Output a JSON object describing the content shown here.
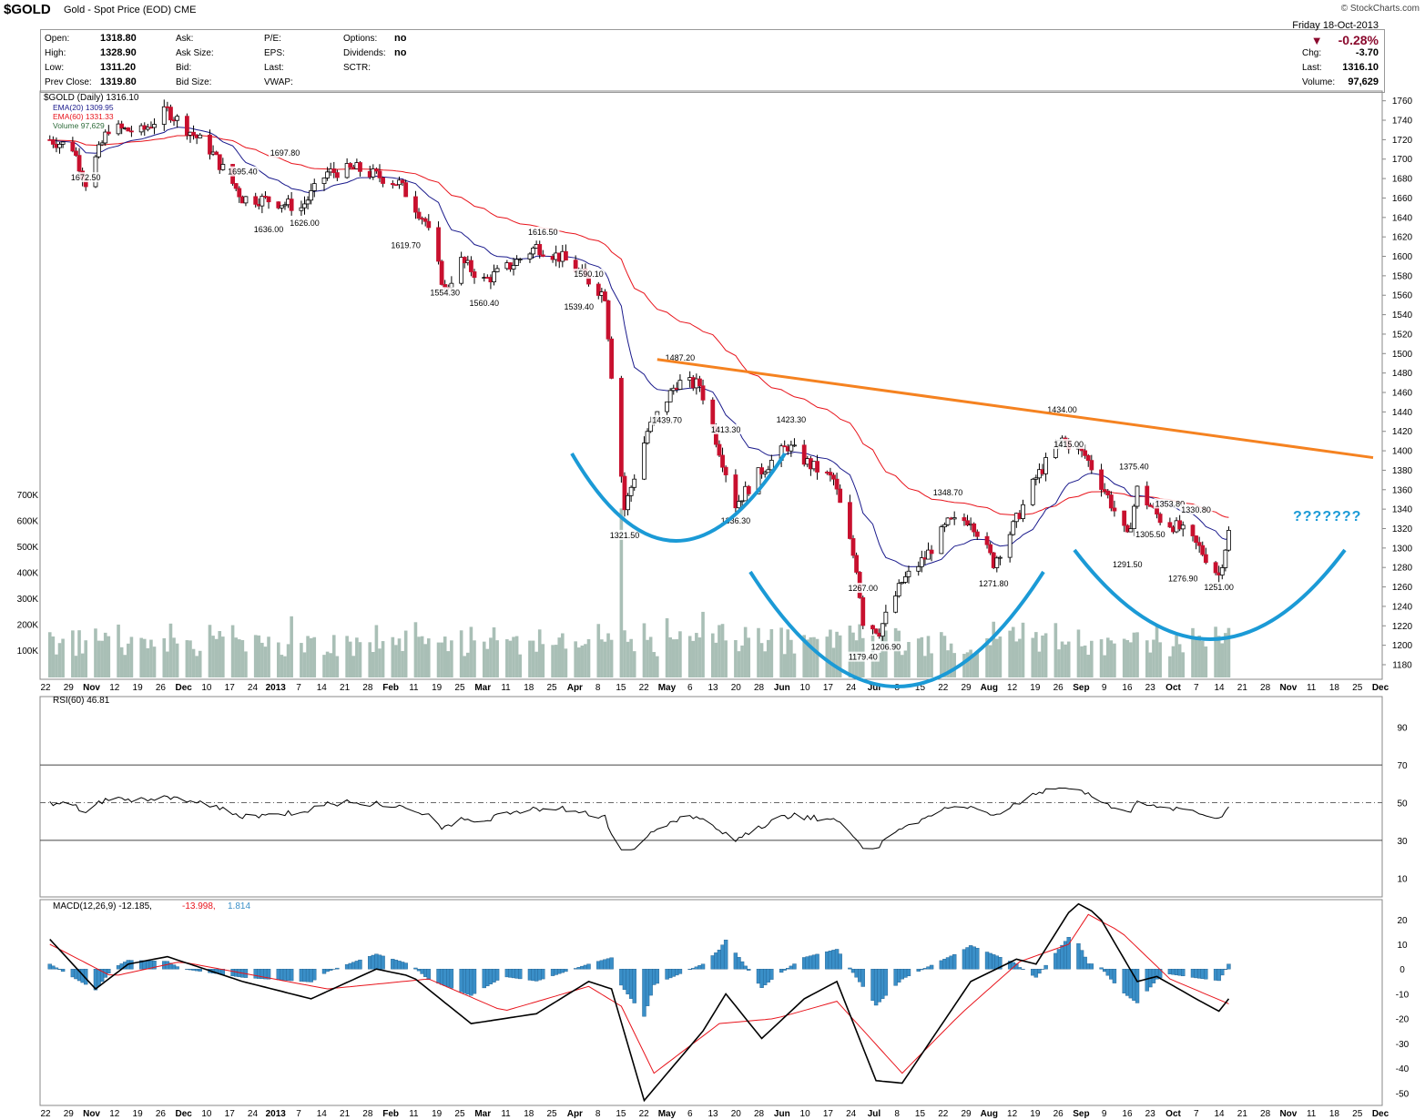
{
  "header": {
    "symbol": "$GOLD",
    "description": "Gold - Spot Price (EOD)",
    "exchange": "CME",
    "brand": "© StockCharts.com",
    "date": "Friday  18-Oct-2013",
    "change_pct": "-0.28%",
    "quote_left": [
      {
        "label": "Open:",
        "value": "1318.80"
      },
      {
        "label": "High:",
        "value": "1328.90"
      },
      {
        "label": "Low:",
        "value": "1311.20"
      },
      {
        "label": "Prev Close:",
        "value": "1319.80"
      }
    ],
    "quote_mid": [
      "Ask:",
      "Ask Size:",
      "Bid:",
      "Bid Size:"
    ],
    "quote_mid2": [
      "P/E:",
      "EPS:",
      "Last:",
      "VWAP:"
    ],
    "quote_mid3": [
      {
        "label": "Options:",
        "value": "no"
      },
      {
        "label": "Dividends:",
        "value": "no"
      },
      {
        "label": "SCTR:",
        "value": ""
      }
    ],
    "quote_right": [
      {
        "label": "Chg:",
        "value": "-3.70"
      },
      {
        "label": "Last:",
        "value": "1316.10"
      },
      {
        "label": "Volume:",
        "value": "97,629"
      }
    ]
  },
  "legend": {
    "price": "$GOLD (Daily) 1316.10",
    "ema20": "EMA(20) 1309.95",
    "ema60": "EMA(60) 1331.33",
    "volume": "Volume 97,629",
    "rsi": "RSI(60) 46.81",
    "macd_label": "MACD(12,26,9)",
    "macd_v1": "-12.185",
    "macd_v2": "-13.998",
    "macd_v3": "1.814"
  },
  "annotation": "???????",
  "colors": {
    "up": "#ffffff",
    "down": "#c8102e",
    "ema20": "#1a1a8c",
    "ema60": "#e8141c",
    "volume": "#a9bfb6",
    "trendline": "#f58220",
    "arcs": "#1b9ad6",
    "macd_hist": "#3a8fc8",
    "macd_line": "#000000",
    "signal_line": "#e8141c"
  },
  "chart_data": [
    {
      "type": "candlestick",
      "title": "$GOLD (Daily) 1316.10",
      "y_axis_ticks": [
        1180,
        1200,
        1220,
        1240,
        1260,
        1280,
        1300,
        1320,
        1340,
        1360,
        1380,
        1400,
        1420,
        1440,
        1460,
        1480,
        1500,
        1520,
        1540,
        1560,
        1580,
        1600,
        1620,
        1640,
        1660,
        1680,
        1700,
        1720,
        1740,
        1760
      ],
      "ylim": [
        1165,
        1770
      ],
      "x_labels": [
        "22",
        "29",
        "Nov",
        "12",
        "19",
        "26",
        "Dec",
        "10",
        "17",
        "24",
        "2013",
        "7",
        "14",
        "21",
        "28",
        "Feb",
        "11",
        "19",
        "25",
        "Mar",
        "11",
        "18",
        "25",
        "Apr",
        "8",
        "15",
        "22",
        "May",
        "6",
        "13",
        "20",
        "28",
        "Jun",
        "10",
        "17",
        "24",
        "Jul",
        "8",
        "15",
        "22",
        "29",
        "Aug",
        "12",
        "19",
        "26",
        "Sep",
        "9",
        "16",
        "23",
        "Oct",
        "7",
        "14",
        "21",
        "28",
        "Nov",
        "11",
        "18",
        "25",
        "Dec"
      ],
      "price_path": [
        [
          "2012-10-22",
          1720
        ],
        [
          "2012-10-29",
          1712
        ],
        [
          "2012-11-02",
          1676
        ],
        [
          "2012-11-09",
          1732
        ],
        [
          "2012-11-19",
          1728
        ],
        [
          "2012-11-27",
          1750
        ],
        [
          "2012-12-10",
          1710
        ],
        [
          "2012-12-20",
          1660
        ],
        [
          "2012-12-28",
          1658
        ],
        [
          "2013-01-07",
          1650
        ],
        [
          "2013-01-15",
          1686
        ],
        [
          "2013-01-24",
          1690
        ],
        [
          "2013-02-06",
          1675
        ],
        [
          "2013-02-14",
          1636
        ],
        [
          "2013-02-20",
          1565
        ],
        [
          "2013-02-25",
          1595
        ],
        [
          "2013-03-04",
          1575
        ],
        [
          "2013-03-11",
          1588
        ],
        [
          "2013-03-20",
          1610
        ],
        [
          "2013-03-28",
          1598
        ],
        [
          "2013-04-05",
          1575
        ],
        [
          "2013-04-10",
          1560
        ],
        [
          "2013-04-12",
          1480
        ],
        [
          "2013-04-16",
          1340
        ],
        [
          "2013-04-23",
          1420
        ],
        [
          "2013-05-02",
          1470
        ],
        [
          "2013-05-09",
          1468
        ],
        [
          "2013-05-16",
          1390
        ],
        [
          "2013-05-20",
          1345
        ],
        [
          "2013-05-28",
          1380
        ],
        [
          "2013-06-05",
          1405
        ],
        [
          "2013-06-12",
          1385
        ],
        [
          "2013-06-19",
          1370
        ],
        [
          "2013-06-26",
          1280
        ],
        [
          "2013-06-28",
          1225
        ],
        [
          "2013-07-03",
          1215
        ],
        [
          "2013-07-10",
          1265
        ],
        [
          "2013-07-17",
          1290
        ],
        [
          "2013-07-24",
          1325
        ],
        [
          "2013-07-31",
          1330
        ],
        [
          "2013-08-07",
          1285
        ],
        [
          "2013-08-13",
          1322
        ],
        [
          "2013-08-20",
          1372
        ],
        [
          "2013-08-28",
          1412
        ],
        [
          "2013-09-04",
          1395
        ],
        [
          "2013-09-10",
          1360
        ],
        [
          "2013-09-17",
          1310
        ],
        [
          "2013-09-20",
          1360
        ],
        [
          "2013-09-27",
          1330
        ],
        [
          "2013-10-03",
          1320
        ],
        [
          "2013-10-09",
          1300
        ],
        [
          "2013-10-15",
          1272
        ],
        [
          "2013-10-18",
          1316
        ]
      ],
      "data_labels": [
        {
          "x": "2012-11-02",
          "text": "1672.50"
        },
        {
          "x": "2012-12-20",
          "text": "1695.40"
        },
        {
          "x": "2013-01-02",
          "text": "1697.80"
        },
        {
          "x": "2012-12-28",
          "text": "1636.00"
        },
        {
          "x": "2013-01-08",
          "text": "1626.00"
        },
        {
          "x": "2013-02-08",
          "text": "1619.70"
        },
        {
          "x": "2013-02-20",
          "text": "1554.30"
        },
        {
          "x": "2013-03-04",
          "text": "1560.40"
        },
        {
          "x": "2013-03-22",
          "text": "1616.50"
        },
        {
          "x": "2013-04-05",
          "text": "1590.10"
        },
        {
          "x": "2013-04-02",
          "text": "1539.40"
        },
        {
          "x": "2013-04-16",
          "text": "1321.50"
        },
        {
          "x": "2013-05-03",
          "text": "1487.20"
        },
        {
          "x": "2013-04-29",
          "text": "1439.70"
        },
        {
          "x": "2013-05-17",
          "text": "1413.30"
        },
        {
          "x": "2013-05-20",
          "text": "1336.30"
        },
        {
          "x": "2013-06-06",
          "text": "1423.30"
        },
        {
          "x": "2013-06-28",
          "text": "1267.00"
        },
        {
          "x": "2013-06-28",
          "text": "1179.40"
        },
        {
          "x": "2013-07-05",
          "text": "1206.90"
        },
        {
          "x": "2013-07-24",
          "text": "1348.70"
        },
        {
          "x": "2013-08-07",
          "text": "1271.80"
        },
        {
          "x": "2013-08-28",
          "text": "1434.00"
        },
        {
          "x": "2013-08-30",
          "text": "1415.00"
        },
        {
          "x": "2013-09-19",
          "text": "1375.40"
        },
        {
          "x": "2013-09-17",
          "text": "1291.50"
        },
        {
          "x": "2013-09-24",
          "text": "1305.50"
        },
        {
          "x": "2013-09-30",
          "text": "1353.80"
        },
        {
          "x": "2013-10-08",
          "text": "1330.80"
        },
        {
          "x": "2013-10-04",
          "text": "1276.90"
        },
        {
          "x": "2013-10-15",
          "text": "1251.00"
        }
      ]
    },
    {
      "type": "bar",
      "title": "Volume 97,629",
      "y_axis_ticks": [
        "100K",
        "200K",
        "300K",
        "400K",
        "500K",
        "600K",
        "700K"
      ]
    },
    {
      "type": "line",
      "title": "RSI(60) 46.81",
      "y_axis_ticks": [
        10,
        30,
        50,
        70,
        90
      ],
      "reference_lines": [
        30,
        50,
        70
      ],
      "ylim": [
        0,
        100
      ]
    },
    {
      "type": "line",
      "title": "MACD(12,26,9) -12.185, -13.998, 1.814",
      "y_axis_ticks": [
        20,
        10,
        0,
        -10,
        -20,
        -30,
        -40,
        -50
      ],
      "ylim": [
        -55,
        28
      ],
      "macd_path": [
        [
          "2012-10-22",
          12
        ],
        [
          "2012-11-05",
          -8
        ],
        [
          "2012-11-15",
          2
        ],
        [
          "2012-11-27",
          5
        ],
        [
          "2012-12-20",
          -5
        ],
        [
          "2013-01-10",
          -12
        ],
        [
          "2013-01-30",
          0
        ],
        [
          "2013-02-10",
          -3
        ],
        [
          "2013-02-28",
          -22
        ],
        [
          "2013-03-20",
          -18
        ],
        [
          "2013-04-05",
          -5
        ],
        [
          "2013-04-12",
          -8
        ],
        [
          "2013-04-22",
          -53
        ],
        [
          "2013-05-10",
          -25
        ],
        [
          "2013-05-17",
          -10
        ],
        [
          "2013-05-28",
          -28
        ],
        [
          "2013-06-10",
          -12
        ],
        [
          "2013-06-20",
          -5
        ],
        [
          "2013-07-02",
          -45
        ],
        [
          "2013-07-10",
          -46
        ],
        [
          "2013-07-31",
          -5
        ],
        [
          "2013-08-14",
          4
        ],
        [
          "2013-08-20",
          2
        ],
        [
          "2013-09-01",
          27
        ],
        [
          "2013-09-08",
          22
        ],
        [
          "2013-09-20",
          -5
        ],
        [
          "2013-09-26",
          -3
        ],
        [
          "2013-10-08",
          -12
        ],
        [
          "2013-10-15",
          -17
        ],
        [
          "2013-10-18",
          -12
        ]
      ],
      "signal_path": [
        [
          "2012-10-22",
          10
        ],
        [
          "2012-11-10",
          -3
        ],
        [
          "2012-12-01",
          3
        ],
        [
          "2013-01-15",
          -8
        ],
        [
          "2013-02-15",
          -4
        ],
        [
          "2013-03-10",
          -17
        ],
        [
          "2013-04-05",
          -7
        ],
        [
          "2013-04-15",
          -15
        ],
        [
          "2013-04-25",
          -42
        ],
        [
          "2013-05-15",
          -22
        ],
        [
          "2013-06-01",
          -20
        ],
        [
          "2013-06-20",
          -13
        ],
        [
          "2013-07-10",
          -42
        ],
        [
          "2013-07-28",
          -18
        ],
        [
          "2013-08-15",
          3
        ],
        [
          "2013-08-30",
          10
        ],
        [
          "2013-09-05",
          22
        ],
        [
          "2013-09-15",
          15
        ],
        [
          "2013-09-30",
          -4
        ],
        [
          "2013-10-18",
          -14
        ]
      ]
    }
  ]
}
